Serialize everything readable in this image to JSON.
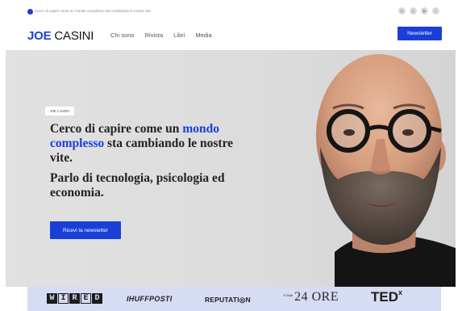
{
  "topbar": {
    "tagline": "Cerco di capire come un mondo complesso sta cambiando le nostre vite",
    "socials": [
      {
        "icon": "linkedin-icon",
        "glyph": "in"
      },
      {
        "icon": "instagram-icon",
        "glyph": "◎"
      },
      {
        "icon": "youtube-icon",
        "glyph": "▶"
      },
      {
        "icon": "tiktok-icon",
        "glyph": "♪"
      }
    ]
  },
  "header": {
    "logo_first": "JOE",
    "logo_last": "CASINI",
    "nav": [
      "Chi sono",
      "Rivista",
      "Libri",
      "Media"
    ],
    "newsletter_button": "Newsletter"
  },
  "hero": {
    "badge": "JOE CASINI",
    "headline_pre": "Cerco di capire come un ",
    "headline_highlight": "mondo complesso",
    "headline_post": " sta cambiando le nostre vite.",
    "subheadline": "Parlo di tecnologia, psicologia ed economia.",
    "cta": "Ricevi la newsletter"
  },
  "press": {
    "wired": [
      "W",
      "I",
      "R",
      "E",
      "D"
    ],
    "huffpost": "IHUFFPOSTI",
    "reputation": "REPUTATI◎N",
    "sole_small": "Il Sole",
    "sole_big": "24 ORE",
    "tedx_main": "TED",
    "tedx_sup": "x"
  },
  "colors": {
    "accent": "#1a3fd9",
    "hero_bg": "#dcdcdc",
    "logos_bg": "#d6dcf3"
  }
}
